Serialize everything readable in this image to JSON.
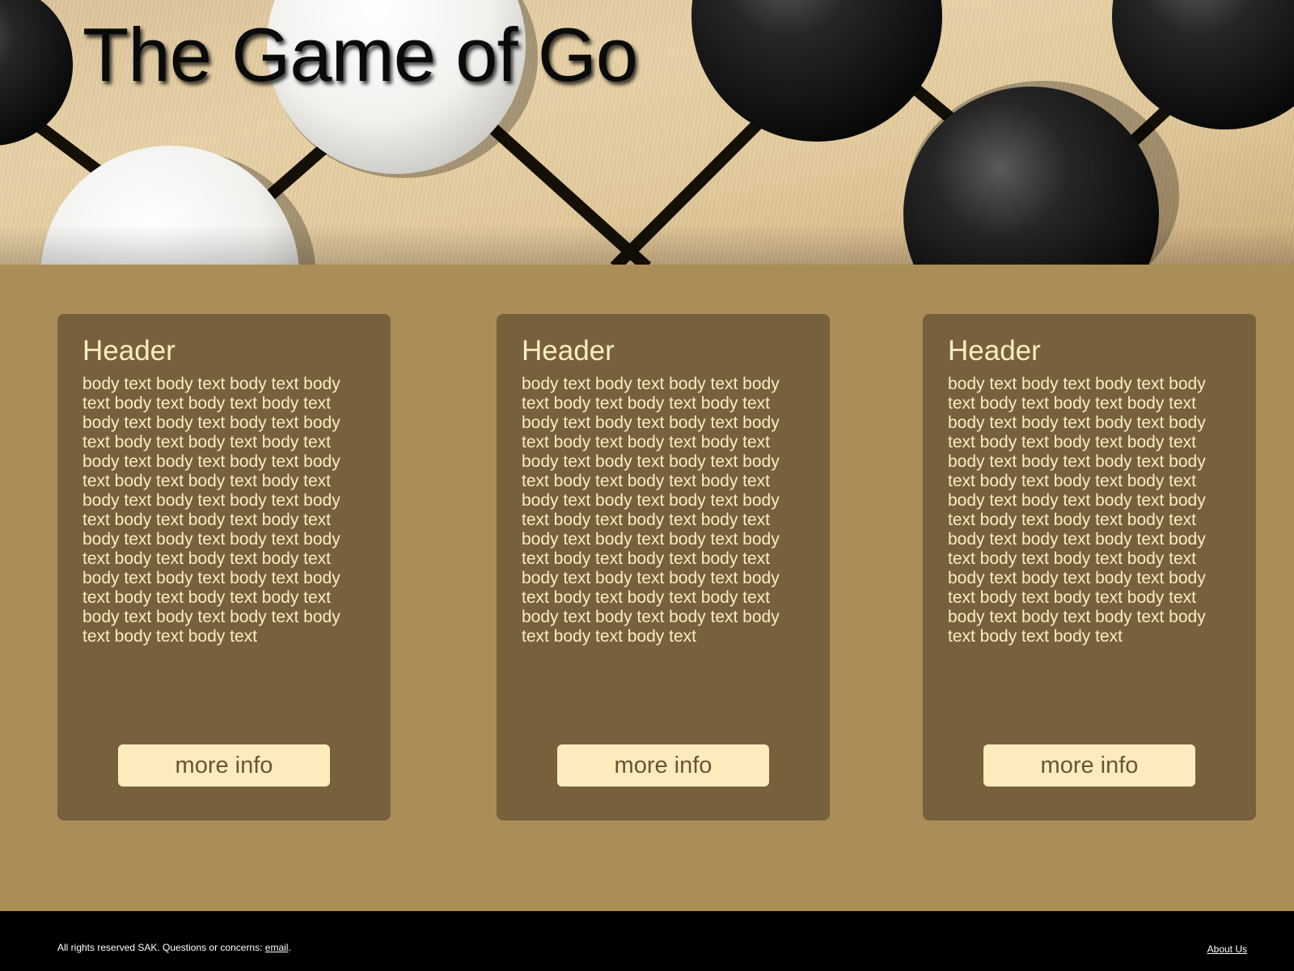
{
  "hero": {
    "title": "The Game of Go",
    "image": "go-board-stones"
  },
  "cards": [
    {
      "header": "Header",
      "body": "body text body text body text body text body text body text body text body text body text body text body text body text body text body text body text body text body text body text body text body text body text body text body text body text body text body text body text body text body text body text body text body text body text body text body text body text body text body text body text body text body text body text body text body text body text body text body text body text",
      "button_label": "more info"
    },
    {
      "header": "Header",
      "body": "body text body text body text body text body text body text body text body text body text body text body text body text body text body text body text body text body text body text body text body text body text body text body text body text body text body text body text body text body text body text body text body text body text body text body text body text body text body text body text body text body text body text body text body text body text body text body text body text",
      "button_label": "more info"
    },
    {
      "header": "Header",
      "body": "body text body text body text body text body text body text body text body text body text body text body text body text body text body text body text body text body text body text body text body text body text body text body text body text body text body text body text body text body text body text body text body text body text body text body text body text body text body text body text body text body text body text body text body text body text body text body text body text",
      "button_label": "more info"
    }
  ],
  "footer": {
    "copyright_text": "All rights reserved SAK. Questions or concerns: ",
    "email_link": "email",
    "period": ".",
    "about_link": "About Us"
  },
  "colors": {
    "page_background": "#ab8e57",
    "card_background": "#77613c",
    "card_text": "#fbecc3",
    "button_background": "#fcebbd",
    "button_text": "#6b5531",
    "footer_background": "#000000"
  }
}
